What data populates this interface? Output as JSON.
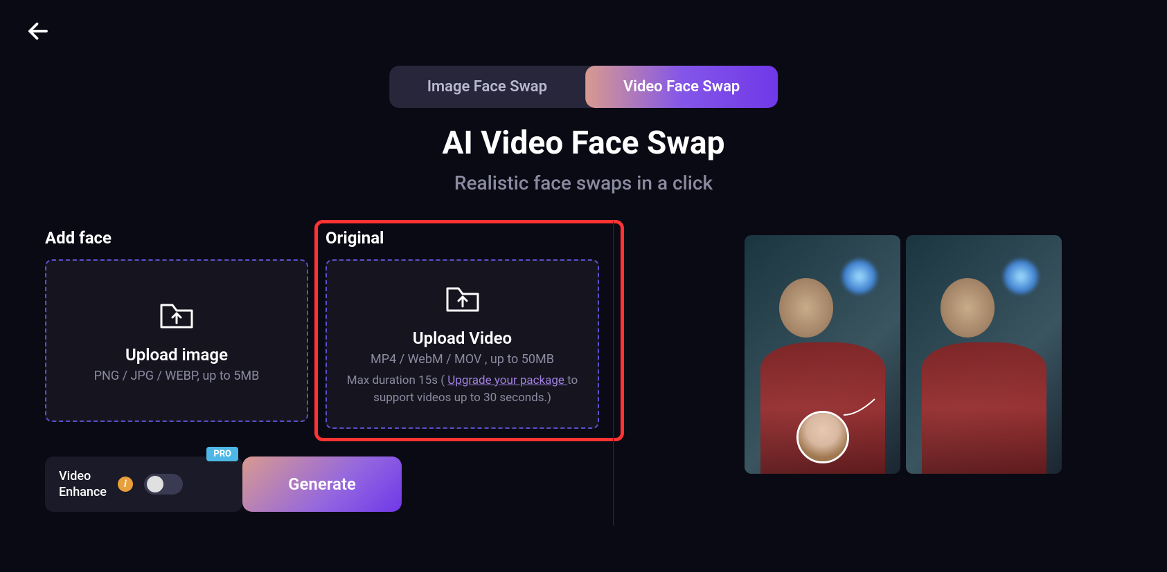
{
  "tabs": {
    "image": "Image Face Swap",
    "video": "Video Face Swap"
  },
  "hero": {
    "title": "AI Video Face Swap",
    "subtitle": "Realistic face swaps in a click"
  },
  "upload": {
    "face": {
      "label": "Add face",
      "title": "Upload image",
      "subtitle": "PNG / JPG / WEBP, up to 5MB"
    },
    "video": {
      "label": "Original",
      "title": "Upload Video",
      "subtitle": "MP4 / WebM / MOV , up to 50MB",
      "detail_prefix": "Max duration 15s ( ",
      "upgrade_link": "Upgrade your package ",
      "detail_suffix": "to support videos up to 30 seconds.)"
    }
  },
  "enhance": {
    "label": "Video Enhance",
    "badge": "PRO",
    "info_letter": "i"
  },
  "generate": {
    "label": "Generate"
  }
}
